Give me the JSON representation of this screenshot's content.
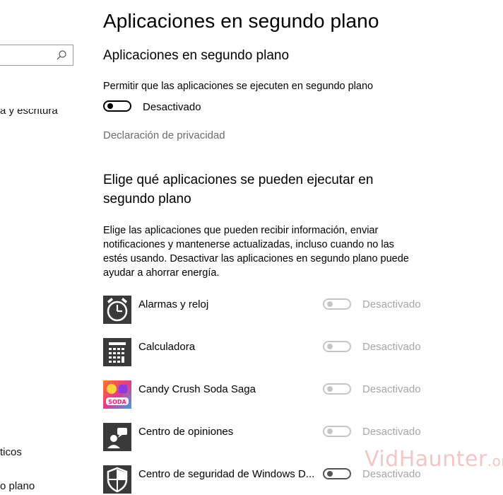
{
  "sidebar": {
    "search_placeholder": "",
    "item_fragment_1": "a y escritura",
    "item_fragment_2": "ticos",
    "item_fragment_3": "o plano"
  },
  "page": {
    "title": "Aplicaciones en segundo plano",
    "section1_heading": "Aplicaciones en segundo plano",
    "allow_label": "Permitir que las aplicaciones se ejecuten en segundo plano",
    "master_toggle_state": "Desactivado",
    "privacy_link": "Declaración de privacidad",
    "section2_heading_line1": "Elige qué aplicaciones se pueden ejecutar en",
    "section2_heading_line2": "segundo plano",
    "description_line1": "Elige las aplicaciones que pueden recibir información, enviar",
    "description_line2": "notificaciones y mantenerse actualizadas, incluso cuando no las",
    "description_line3": "estés usando. Desactivar las aplicaciones en segundo plano puede",
    "description_line4": "ayudar a ahorrar energía."
  },
  "apps": [
    {
      "name": "Alarmas y reloj",
      "state": "Desactivado",
      "icon": "alarm-clock-icon"
    },
    {
      "name": "Calculadora",
      "state": "Desactivado",
      "icon": "calculator-icon"
    },
    {
      "name": "Candy Crush Soda Saga",
      "state": "Desactivado",
      "icon": "candy-crush-icon"
    },
    {
      "name": "Centro de opiniones",
      "state": "Desactivado",
      "icon": "feedback-hub-icon"
    },
    {
      "name": "Centro de seguridad de Windows D...",
      "state": "Desactivado",
      "icon": "shield-icon"
    }
  ],
  "watermark": {
    "main": "VidHaunter",
    "suffix": ".org"
  },
  "colors": {
    "icon_bg_dark": "#3a3a3a",
    "disabled_text": "#a6a6a6",
    "muted_text": "#6b6b6b"
  }
}
